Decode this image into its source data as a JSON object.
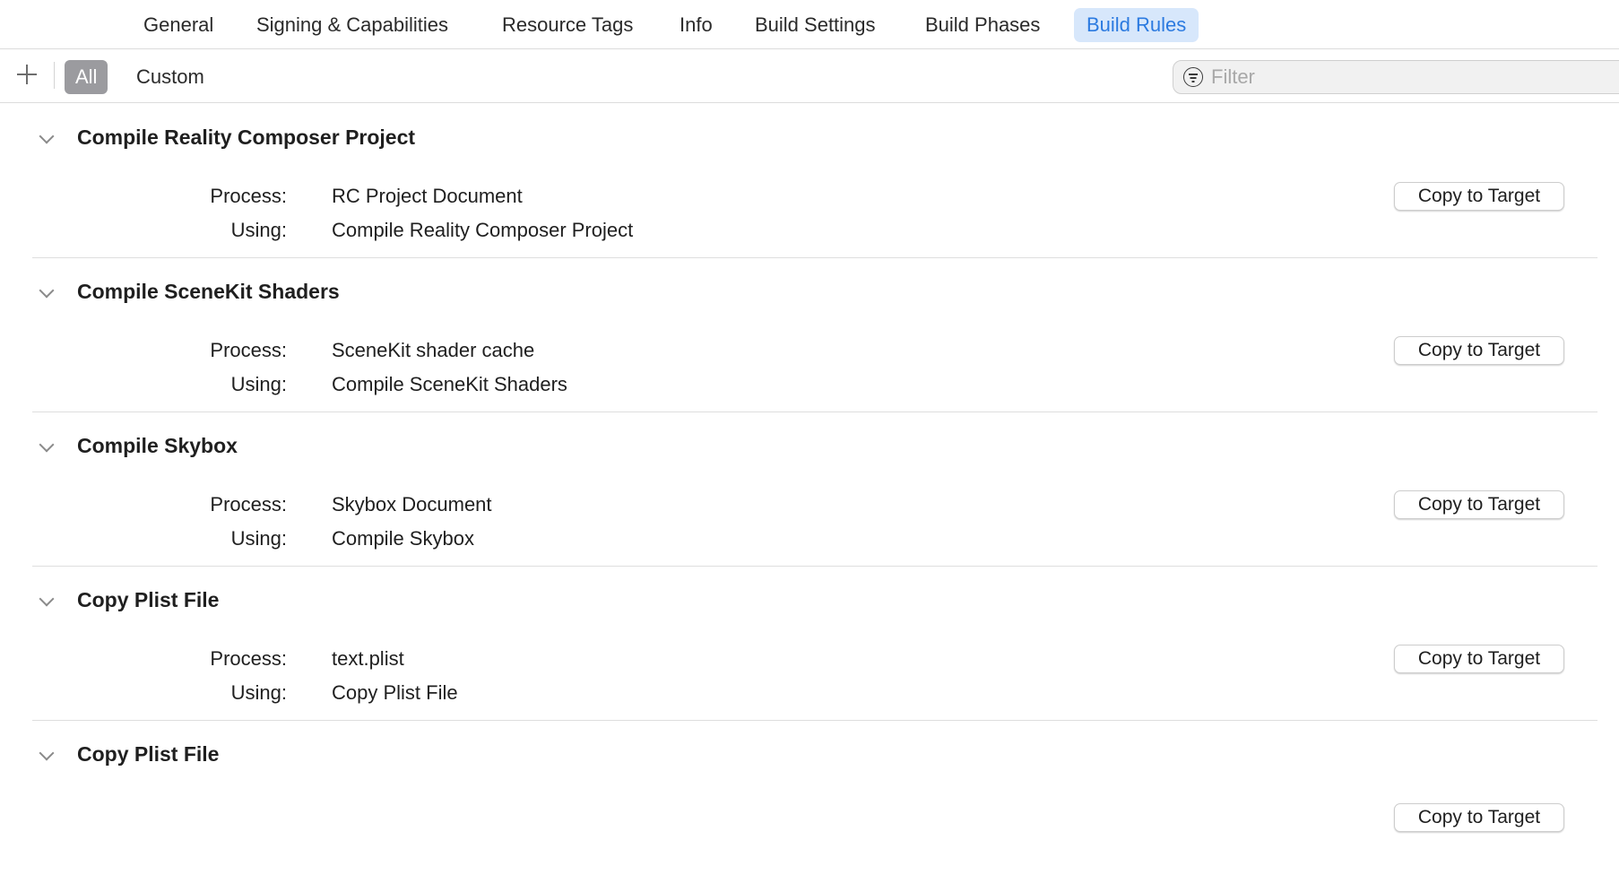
{
  "tabs": [
    {
      "label": "General"
    },
    {
      "label": "Signing & Capabilities"
    },
    {
      "label": "Resource Tags"
    },
    {
      "label": "Info"
    },
    {
      "label": "Build Settings"
    },
    {
      "label": "Build Phases"
    },
    {
      "label": "Build Rules",
      "active": true
    }
  ],
  "toolbar": {
    "add_icon": "plus-icon",
    "segments": {
      "all_label": "All",
      "custom_label": "Custom",
      "selected": "All"
    },
    "filter": {
      "icon": "filter-icon",
      "placeholder": "Filter",
      "value": ""
    }
  },
  "labels": {
    "process": "Process:",
    "using": "Using:"
  },
  "rules": [
    {
      "title": "Compile Reality Composer Project",
      "process": "RC Project Document",
      "using": "Compile Reality Composer Project",
      "button": "Copy to Target"
    },
    {
      "title": "Compile SceneKit Shaders",
      "process": "SceneKit shader cache",
      "using": "Compile SceneKit Shaders",
      "button": "Copy to Target"
    },
    {
      "title": "Compile Skybox",
      "process": "Skybox Document",
      "using": "Compile Skybox",
      "button": "Copy to Target"
    },
    {
      "title": "Copy Plist File",
      "process": "text.plist",
      "using": "Copy Plist File",
      "button": "Copy to Target"
    },
    {
      "title": "Copy Plist File",
      "process": "",
      "using": "",
      "button": "Copy to Target"
    }
  ],
  "colors": {
    "accent": "#2b7ae0",
    "active_tab_bg": "#d7e7fb",
    "segment_selected_bg": "#9b9b9f"
  }
}
